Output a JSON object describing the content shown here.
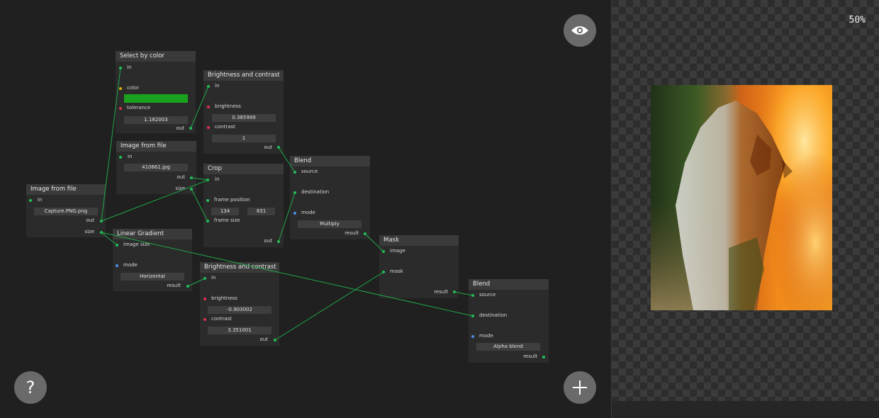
{
  "nodes": {
    "select_by_color": {
      "title": "Select by color",
      "in_label": "in",
      "color_label": "color",
      "color_value": "#1aa21e",
      "tolerance_label": "tolerance",
      "tolerance": "1.182003",
      "out_label": "out"
    },
    "bc1": {
      "title": "Brightness and contrast",
      "in_label": "in",
      "brightness_label": "brightness",
      "brightness": "0.385999",
      "contrast_label": "contrast",
      "contrast": "1",
      "out_label": "out"
    },
    "image_file1": {
      "title": "Image from file",
      "in_label": "in",
      "file": "410661.jpg",
      "out_label": "out",
      "size_label": "size"
    },
    "image_file2": {
      "title": "Image from file",
      "in_label": "in",
      "file": "Capture.PNG.png",
      "out_label": "out",
      "size_label": "size"
    },
    "crop": {
      "title": "Crop",
      "in_label": "in",
      "frame_position_label": "frame position",
      "pos_x": "134",
      "pos_y": "831",
      "frame_size_label": "frame size",
      "out_label": "out"
    },
    "blend1": {
      "title": "Blend",
      "source_label": "source",
      "destination_label": "destination",
      "mode_label": "mode",
      "mode": "Multiply",
      "result_label": "result"
    },
    "linear_gradient": {
      "title": "Linear Gradient",
      "image_size_label": "image size",
      "mode_label": "mode",
      "mode": "Horizontal",
      "result_label": "result"
    },
    "bc2": {
      "title": "Brightness and contrast",
      "in_label": "in",
      "brightness_label": "brightness",
      "brightness": "-0.903002",
      "contrast_label": "contrast",
      "contrast": "3.351001",
      "out_label": "out"
    },
    "mask": {
      "title": "Mask",
      "image_label": "image",
      "mask_label": "mask",
      "result_label": "result"
    },
    "blend2": {
      "title": "Blend",
      "source_label": "source",
      "destination_label": "destination",
      "mode_label": "mode",
      "mode": "Alpha blend",
      "result_label": "result"
    }
  },
  "toolbar": {
    "preview_toggle_icon": "eye-icon",
    "help_label": "?",
    "add_node_icon": "plus-icon"
  },
  "preview": {
    "zoom": "50%"
  },
  "colors": {
    "wire": "#1fa84a",
    "port_image": "#22c25a",
    "port_number": "#e03050",
    "port_mode": "#4a8fe8",
    "port_color": "#d8b010"
  }
}
